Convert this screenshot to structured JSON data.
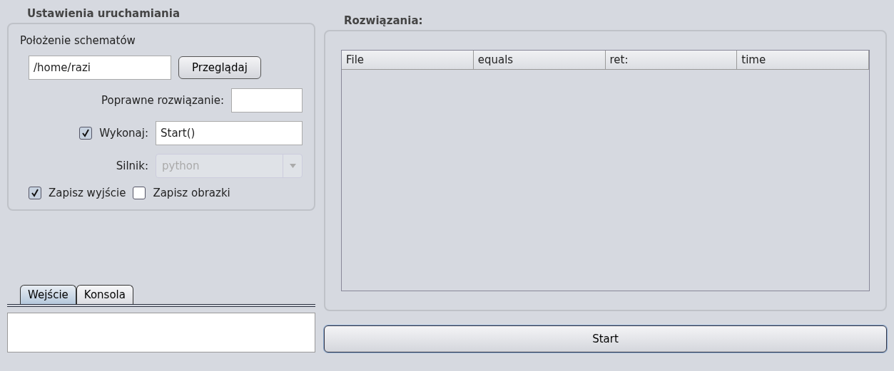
{
  "settings": {
    "title": "Ustawienia uruchamiania",
    "location_label": "Położenie schematów",
    "path": {
      "value": "/home/razi"
    },
    "browse_button": "Przeglądaj",
    "correct_solution": {
      "label": "Poprawne rozwiązanie:"
    },
    "execute": {
      "label": "Wykonaj:",
      "checked": true,
      "value": "Start()"
    },
    "engine": {
      "label": "Silnik:",
      "value": "python",
      "disabled": true
    },
    "options": [
      {
        "label": "Zapisz wyjście",
        "checked": true
      },
      {
        "label": "Zapisz obrazki",
        "checked": false
      }
    ]
  },
  "tabs": [
    {
      "label": "Wejście",
      "selected": true
    },
    {
      "label": "Konsola",
      "selected": false
    }
  ],
  "solutions": {
    "title": "Rozwiązania:",
    "columns": [
      "File",
      "equals",
      "ret:",
      "time"
    ]
  },
  "start_button": "Start"
}
